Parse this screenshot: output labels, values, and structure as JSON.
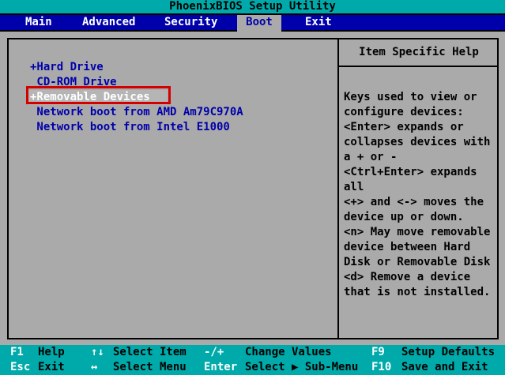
{
  "title": "PhoenixBIOS Setup Utility",
  "menu": {
    "items": [
      {
        "label": "Main",
        "selected": false
      },
      {
        "label": "Advanced",
        "selected": false
      },
      {
        "label": "Security",
        "selected": false
      },
      {
        "label": "Boot",
        "selected": true
      },
      {
        "label": "Exit",
        "selected": false
      }
    ]
  },
  "boot_list": {
    "items": [
      {
        "label": "+Hard Drive",
        "selected": false
      },
      {
        "label": " CD-ROM Drive",
        "selected": false
      },
      {
        "label": "+Removable Devices",
        "selected": true
      },
      {
        "label": " Network boot from AMD Am79C970A",
        "selected": false
      },
      {
        "label": " Network boot from Intel E1000",
        "selected": false
      }
    ]
  },
  "help_panel": {
    "heading": "Item Specific Help",
    "lines": [
      "Keys used to view or",
      "configure devices:",
      "<Enter> expands or",
      "collapses devices with",
      "a + or -",
      "<Ctrl+Enter> expands",
      "all",
      "<+> and <-> moves the",
      "device up or down.",
      "<n> May move removable",
      "device between Hard",
      "Disk or Removable Disk",
      "<d> Remove a device",
      "that is not installed."
    ]
  },
  "legend": {
    "rows": [
      {
        "entries": [
          {
            "key": "F1",
            "label": "Help"
          },
          {
            "key": "↑↓",
            "label": "Select Item"
          },
          {
            "key": "-/+",
            "label": "Change Values"
          },
          {
            "key": "F9",
            "label": "Setup Defaults"
          }
        ]
      },
      {
        "entries": [
          {
            "key": "Esc",
            "label": "Exit"
          },
          {
            "key": "↔",
            "label": "Select Menu"
          },
          {
            "key": "Enter",
            "label": "Select ▶ Sub-Menu"
          },
          {
            "key": "F10",
            "label": "Save and Exit"
          }
        ]
      }
    ]
  },
  "colors": {
    "teal": "#00AAAA",
    "menu_blue": "#0000AA",
    "background_grey": "#AAAAAA",
    "item_text_blue": "#0000AA",
    "selected_item_bg": "#B5B5B5",
    "selected_item_text": "#FFFFFF",
    "annotation_red": "#D40000",
    "text_black": "#000000",
    "key_text_white": "#FFFFFF"
  }
}
